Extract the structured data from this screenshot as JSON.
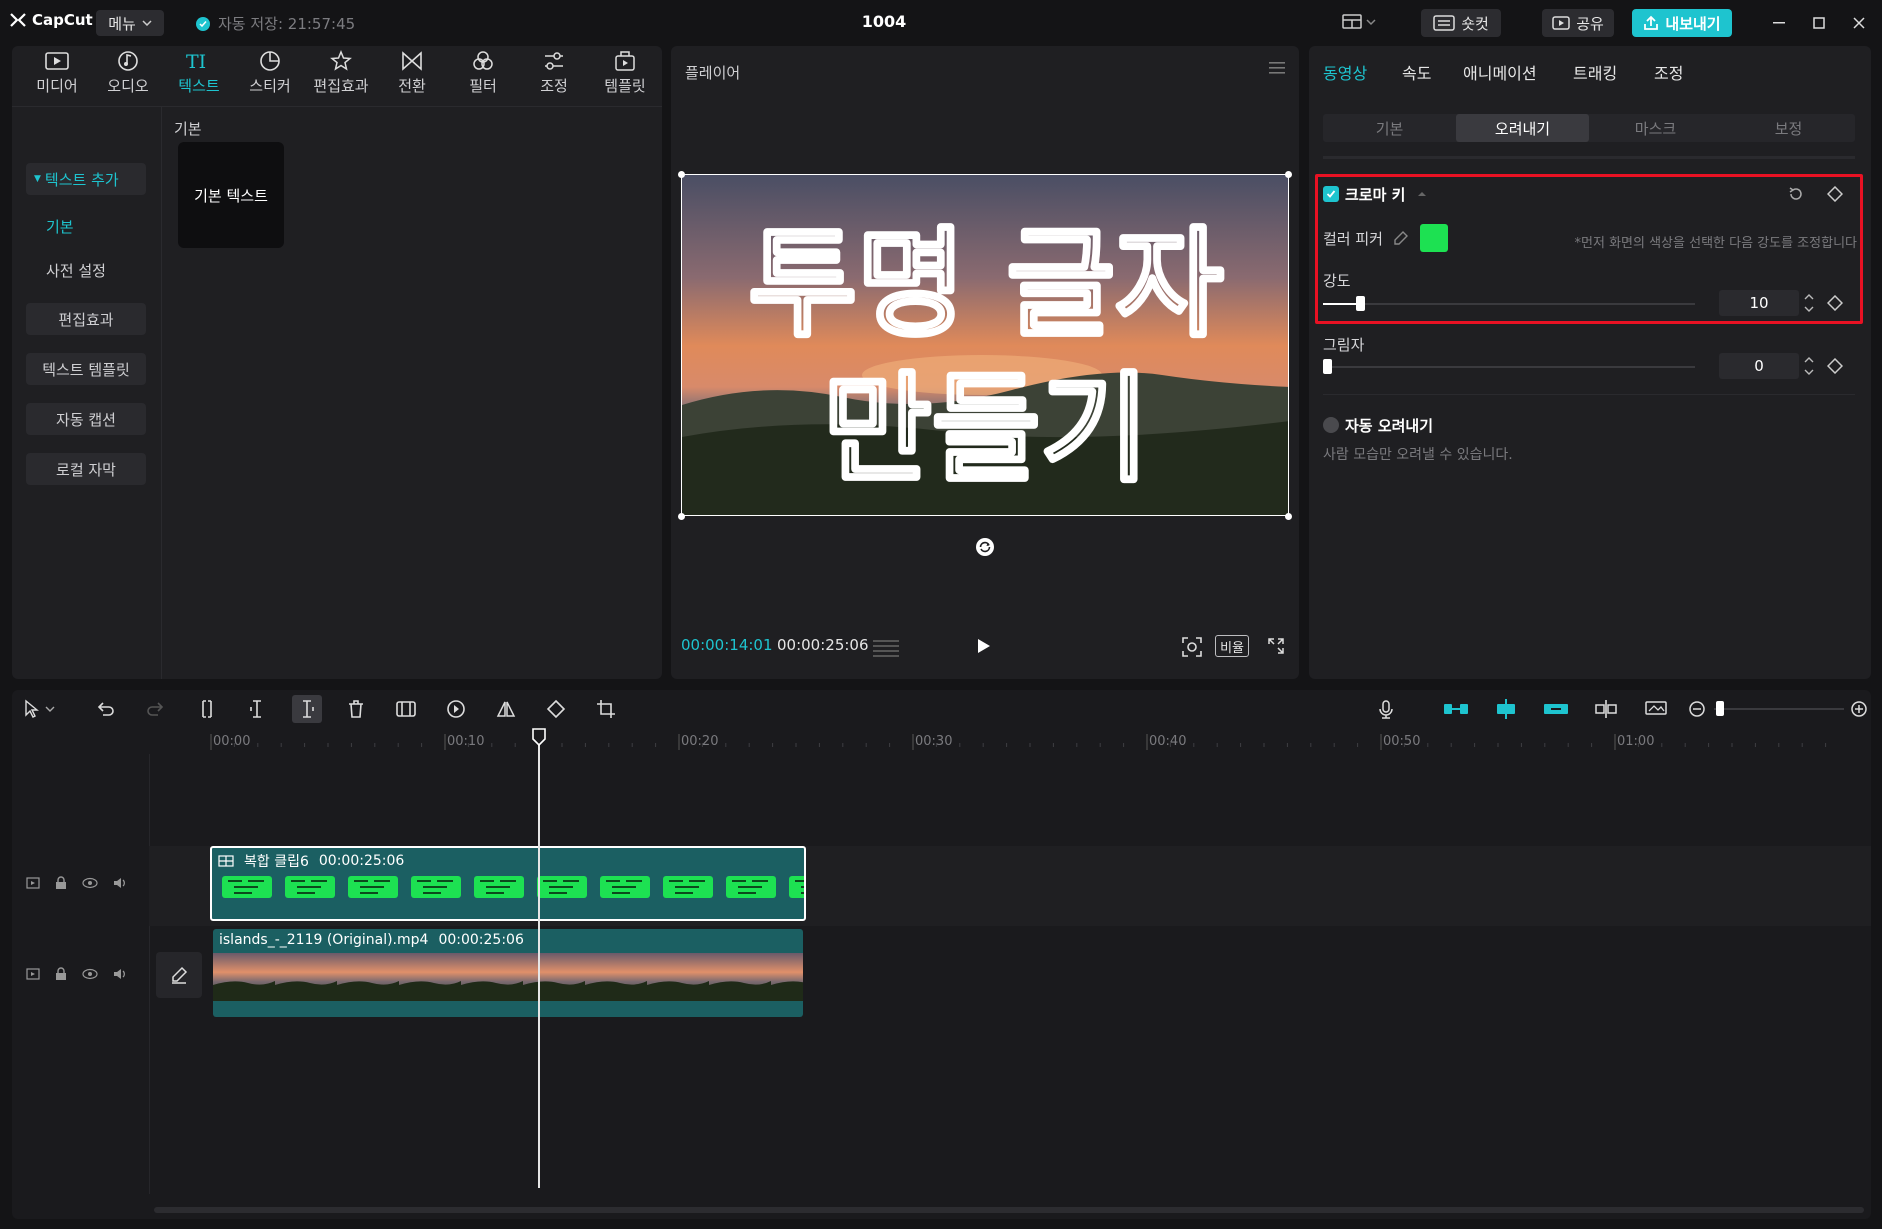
{
  "app": {
    "logo_text": "CapCut",
    "menu_label": "메뉴",
    "autosave_text": "자동 저장: 21:57:45",
    "project_title": "1004",
    "shortcut_label": "숏컷",
    "share_label": "공유",
    "export_label": "내보내기"
  },
  "media_panel": {
    "tabs": [
      {
        "label": "미디어",
        "icon": "media-icon"
      },
      {
        "label": "오디오",
        "icon": "audio-icon"
      },
      {
        "label": "텍스트",
        "icon": "text-icon"
      },
      {
        "label": "스티커",
        "icon": "sticker-icon"
      },
      {
        "label": "편집효과",
        "icon": "effects-icon"
      },
      {
        "label": "전환",
        "icon": "transition-icon"
      },
      {
        "label": "필터",
        "icon": "filter-icon"
      },
      {
        "label": "조정",
        "icon": "adjust-icon"
      },
      {
        "label": "템플릿",
        "icon": "template-icon"
      }
    ],
    "active_tab": "텍스트",
    "nav": {
      "add_text": "텍스트 추가",
      "basic": "기본",
      "presets": "사전 설정",
      "effects": "편집효과",
      "text_template": "텍스트 템플릿",
      "auto_caption": "자동 캡션",
      "local_caption": "로컬 자막"
    },
    "section_label": "기본",
    "card_label": "기본 텍스트"
  },
  "player": {
    "title": "플레이어",
    "overlay_line1": "투명 글자",
    "overlay_line2": "만들기",
    "current_time": "00:00:14:01",
    "total_time": "00:00:25:06",
    "ratio_label": "비율"
  },
  "properties": {
    "tabs": [
      "동영상",
      "속도",
      "애니메이션",
      "트래킹",
      "조정"
    ],
    "active_tab": "동영상",
    "sub_tabs": [
      "기본",
      "오려내기",
      "마스크",
      "보정"
    ],
    "active_sub_tab": "오려내기",
    "chroma_key": {
      "label": "크로마 키",
      "enabled": true,
      "color_picker_label": "컬러 피커",
      "picked_color": "#1de152",
      "hint": "*먼저 화면의 색상을 선택한 다음 강도를 조정합니다",
      "intensity_label": "강도",
      "intensity_value": "10",
      "intensity_fraction": 0.1,
      "shadow_label": "그림자",
      "shadow_value": "0",
      "shadow_fraction": 0
    },
    "auto_cutout": {
      "label": "자동 오려내기",
      "enabled": false,
      "description": "사람 모습만 오려낼 수 있습니다."
    }
  },
  "timeline": {
    "ticks": [
      "00:00",
      "00:10",
      "00:20",
      "00:30",
      "00:40",
      "00:50",
      "01:00"
    ],
    "playhead_fraction": 0.233,
    "tracks": [
      {
        "clip_name": "복합 클립6",
        "duration": "00:00:25:06"
      },
      {
        "clip_name": "islands_-_2119 (Original).mp4",
        "duration": "00:00:25:06"
      }
    ]
  },
  "colors": {
    "accent": "#1ec4cf",
    "highlight": "#e81123",
    "panel": "#1f1f22",
    "background": "#141416"
  }
}
